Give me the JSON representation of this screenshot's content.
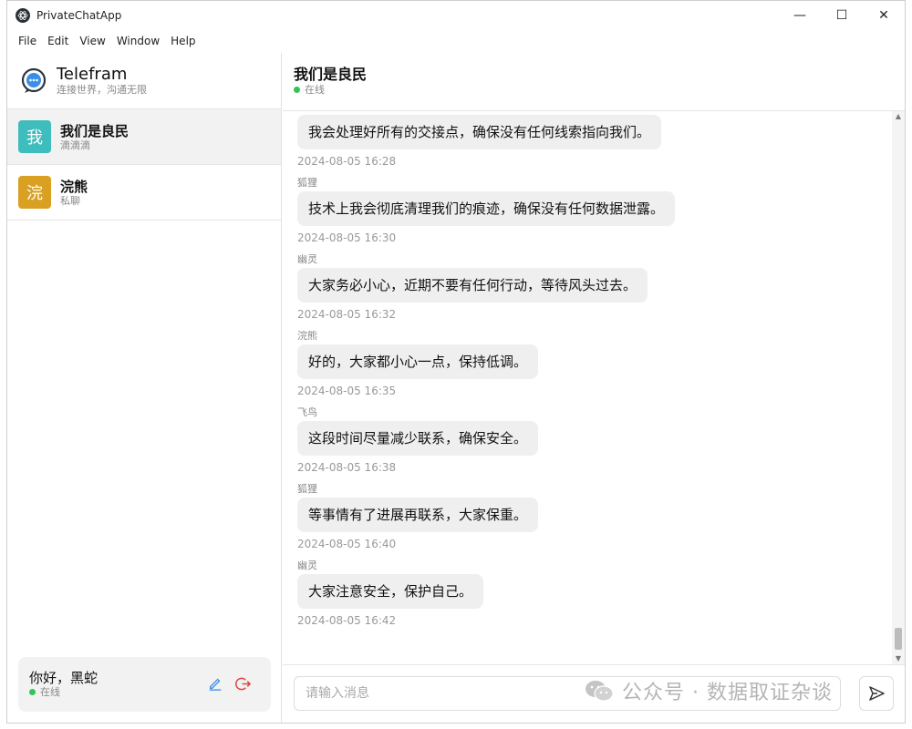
{
  "window": {
    "title": "PrivateChatApp",
    "controls": [
      "—",
      "☐",
      "✕"
    ]
  },
  "menu": [
    "File",
    "Edit",
    "View",
    "Window",
    "Help"
  ],
  "brand": {
    "name": "Telefram",
    "tagline": "连接世界，沟通无限"
  },
  "conversations": [
    {
      "avatar_char": "我",
      "name": "我们是良民",
      "sub": "滴滴滴",
      "color": "#3fbcbc"
    },
    {
      "avatar_char": "浣",
      "name": "浣熊",
      "sub": "私聊",
      "color": "#d9a022"
    }
  ],
  "user": {
    "greeting": "你好，黑蛇",
    "status": "在线"
  },
  "chat": {
    "title": "我们是良民",
    "status": "在线",
    "messages": [
      {
        "sender": "",
        "text": "我会处理好所有的交接点，确保没有任何线索指向我们。",
        "time": "2024-08-05 16:28"
      },
      {
        "sender": "狐狸",
        "text": "技术上我会彻底清理我们的痕迹，确保没有任何数据泄露。",
        "time": "2024-08-05 16:30"
      },
      {
        "sender": "幽灵",
        "text": "大家务必小心，近期不要有任何行动，等待风头过去。",
        "time": "2024-08-05 16:32"
      },
      {
        "sender": "浣熊",
        "text": "好的，大家都小心一点，保持低调。",
        "time": "2024-08-05 16:35"
      },
      {
        "sender": "飞鸟",
        "text": "这段时间尽量减少联系，确保安全。",
        "time": "2024-08-05 16:38"
      },
      {
        "sender": "狐狸",
        "text": "等事情有了进展再联系，大家保重。",
        "time": "2024-08-05 16:40"
      },
      {
        "sender": "幽灵",
        "text": "大家注意安全，保护自己。",
        "time": "2024-08-05 16:42"
      }
    ]
  },
  "composer": {
    "placeholder": "请输入消息"
  },
  "watermark": {
    "text": "公众号 · 数据取证杂谈"
  },
  "colors": {
    "online": "#34c25b",
    "edit_icon": "#3a8ee6",
    "logout_icon": "#e0443e"
  },
  "icons": {
    "app": "atom-icon",
    "brand": "chat-bubble-icon",
    "edit": "pencil-icon",
    "logout": "logout-icon",
    "send": "send-icon"
  }
}
